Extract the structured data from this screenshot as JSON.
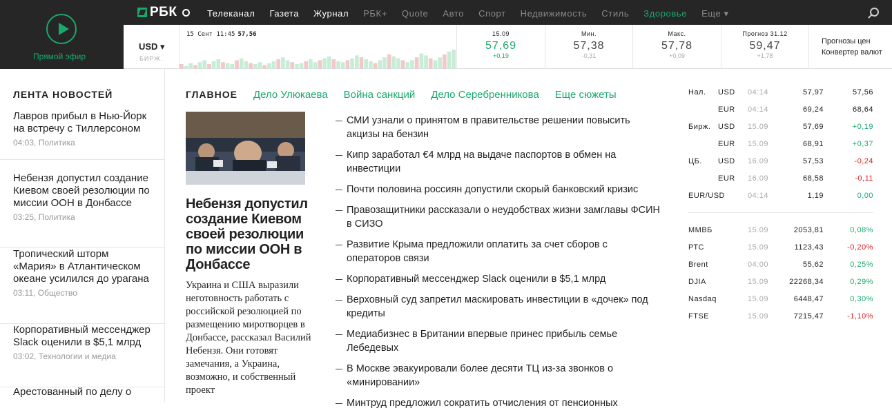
{
  "live": {
    "label": "Прямой эфир"
  },
  "logo": {
    "text": "РБК"
  },
  "nav": [
    {
      "label": "Телеканал",
      "color": "#ffffff"
    },
    {
      "label": "Газета",
      "color": "#ffffff"
    },
    {
      "label": "Журнал",
      "color": "#ffffff"
    },
    {
      "label": "РБК+",
      "color": "#888888"
    },
    {
      "label": "Quote",
      "color": "#888888"
    },
    {
      "label": "Авто",
      "color": "#888888"
    },
    {
      "label": "Спорт",
      "color": "#888888"
    },
    {
      "label": "Недвижимость",
      "color": "#888888"
    },
    {
      "label": "Стиль",
      "color": "#888888"
    },
    {
      "label": "Здоровье",
      "color": "#19a96b"
    },
    {
      "label": "Еще ▾",
      "color": "#888888"
    }
  ],
  "quotes": {
    "currency": "USD ▾",
    "source": "БИРЖ.",
    "spark_time": "15 Сент 11:45",
    "spark_value": "57,56",
    "cells": [
      {
        "label": "15.09",
        "price": "57,69",
        "delta": "+0,19",
        "color": "#19a96b",
        "dcolor": "#19a96b"
      },
      {
        "label": "Мин.",
        "price": "57,38",
        "delta": "-0,31",
        "color": "#444444",
        "dcolor": "#aaaaaa"
      },
      {
        "label": "Макс.",
        "price": "57,78",
        "delta": "+0,09",
        "color": "#444444",
        "dcolor": "#aaaaaa"
      },
      {
        "label": "Прогноз 31.12",
        "price": "59,47",
        "delta": "+1,78",
        "color": "#444444",
        "dcolor": "#aaaaaa"
      }
    ],
    "links": [
      "Прогнозы цен",
      "Конвертер валют"
    ]
  },
  "feed": {
    "title": "ЛЕНТА НОВОСТЕЙ",
    "items": [
      {
        "title": "Лавров прибыл в Нью-Йорк на встречу с Тиллерсоном",
        "meta": "04:03, Политика"
      },
      {
        "title": "Небензя допустил создание Киевом своей резолюции по миссии ООН в Донбассе",
        "meta": "03:25, Политика"
      },
      {
        "title": "Тропический шторм «Мария» в Атлантическом океане усилился до урагана",
        "meta": "03:11, Общество"
      },
      {
        "title": "Корпоративный мессенджер Slack оценили в $5,1 млрд",
        "meta": "03:02, Технологии и медиа"
      },
      {
        "title": "Арестованный по делу о",
        "meta": ""
      }
    ]
  },
  "tabs": [
    {
      "label": "ГЛАВНОЕ",
      "color": "#222222"
    },
    {
      "label": "Дело Улюкаева",
      "color": "#19a96b"
    },
    {
      "label": "Война санкций",
      "color": "#19a96b"
    },
    {
      "label": "Дело Серебренникова",
      "color": "#19a96b"
    },
    {
      "label": "Еще сюжеты",
      "color": "#19a96b"
    }
  ],
  "main_story": {
    "headline": "Небензя допустил создание Киевом своей резолюции по миссии ООН в Донбассе",
    "lead": "Украина и США выразили неготовность работать с российской резолюцией по размещению миротворцев в Донбассе, рассказал Василий Небензя. Они готовят замечания, а Украина, возможно, и собственный проект"
  },
  "news": [
    "СМИ узнали о принятом в правительстве решении повысить акцизы на бензин",
    "Кипр заработал €4 млрд на выдаче паспортов в обмен на инвестиции",
    "Почти половина россиян допустили скорый банковский кризис",
    "Правозащитники рассказали о неудобствах жизни замглавы ФСИН в СИЗО",
    "Развитие Крыма предложили оплатить за счет сборов с операторов связи",
    "Корпоративный мессенджер Slack оценили в $5,1 млрд",
    "Верховный суд запретил маскировать инвестиции в «дочек» под кредиты",
    "Медиабизнес в Британии впервые принес прибыль семье Лебедевых",
    "В Москве эвакуировали более десяти ТЦ из-за звонков о «минировании»",
    "Минтруд предложил сократить отчисления от пенсионных"
  ],
  "rates": [
    {
      "group": "Нал.",
      "cur": "USD",
      "date": "04:14",
      "v1": "57,97",
      "v2": "57,56",
      "c2": "#222222"
    },
    {
      "group": "",
      "cur": "EUR",
      "date": "04:14",
      "v1": "69,24",
      "v2": "68,64",
      "c2": "#222222"
    },
    {
      "group": "Бирж.",
      "cur": "USD",
      "date": "15.09",
      "v1": "57,69",
      "v2": "+0,19",
      "c2": "#19a96b"
    },
    {
      "group": "",
      "cur": "EUR",
      "date": "15.09",
      "v1": "68,91",
      "v2": "+0,37",
      "c2": "#19a96b"
    },
    {
      "group": "ЦБ.",
      "cur": "USD",
      "date": "16.09",
      "v1": "57,53",
      "v2": "-0,24",
      "c2": "#e02020"
    },
    {
      "group": "",
      "cur": "EUR",
      "date": "16.09",
      "v1": "68,58",
      "v2": "-0,11",
      "c2": "#e02020"
    },
    {
      "group": "EUR/USD",
      "cur": "",
      "date": "04:14",
      "v1": "1,19",
      "v2": "0,00",
      "c2": "#19a96b"
    }
  ],
  "indices": [
    {
      "name": "ММВБ",
      "date": "15.09",
      "v1": "2053,81",
      "v2": "0,08%",
      "c2": "#19a96b"
    },
    {
      "name": "РТС",
      "date": "15.09",
      "v1": "1123,43",
      "v2": "-0,20%",
      "c2": "#e02020"
    },
    {
      "name": "Brent",
      "date": "04:00",
      "v1": "55,62",
      "v2": "0,25%",
      "c2": "#19a96b"
    },
    {
      "name": "DJIA",
      "date": "15.09",
      "v1": "22268,34",
      "v2": "0,29%",
      "c2": "#19a96b"
    },
    {
      "name": "Nasdaq",
      "date": "15.09",
      "v1": "6448,47",
      "v2": "0,30%",
      "c2": "#19a96b"
    },
    {
      "name": "FTSE",
      "date": "15.09",
      "v1": "7215,47",
      "v2": "-1,10%",
      "c2": "#e02020"
    }
  ]
}
